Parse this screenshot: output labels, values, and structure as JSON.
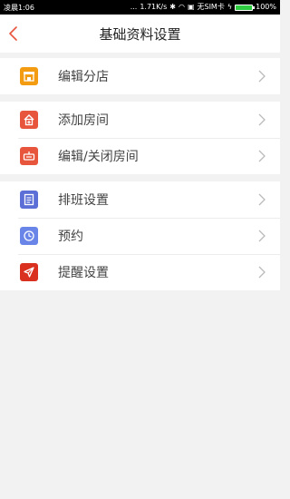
{
  "status_bar": {
    "left": "凌晨1:06",
    "dots": "...",
    "speed": "1.71K/s",
    "sim": "无SIM卡",
    "battery": "100%"
  },
  "header": {
    "title": "基础资料设置"
  },
  "groups": [
    {
      "items": [
        {
          "label": "编辑分店",
          "icon": "store-icon",
          "color": "#f39c12"
        }
      ]
    },
    {
      "items": [
        {
          "label": "添加房间",
          "icon": "add-room-icon",
          "color": "#e8553d"
        },
        {
          "label": "编辑/关闭房间",
          "icon": "close-room-icon",
          "color": "#e8553d"
        }
      ]
    },
    {
      "items": [
        {
          "label": "排班设置",
          "icon": "schedule-icon",
          "color": "#5b6fd6"
        },
        {
          "label": "预约",
          "icon": "clock-icon",
          "color": "#6a85e8"
        },
        {
          "label": "提醒设置",
          "icon": "reminder-icon",
          "color": "#d9301f"
        }
      ]
    }
  ],
  "colors": {
    "back_arrow": "#e8553d",
    "background": "#f2f2f2"
  }
}
